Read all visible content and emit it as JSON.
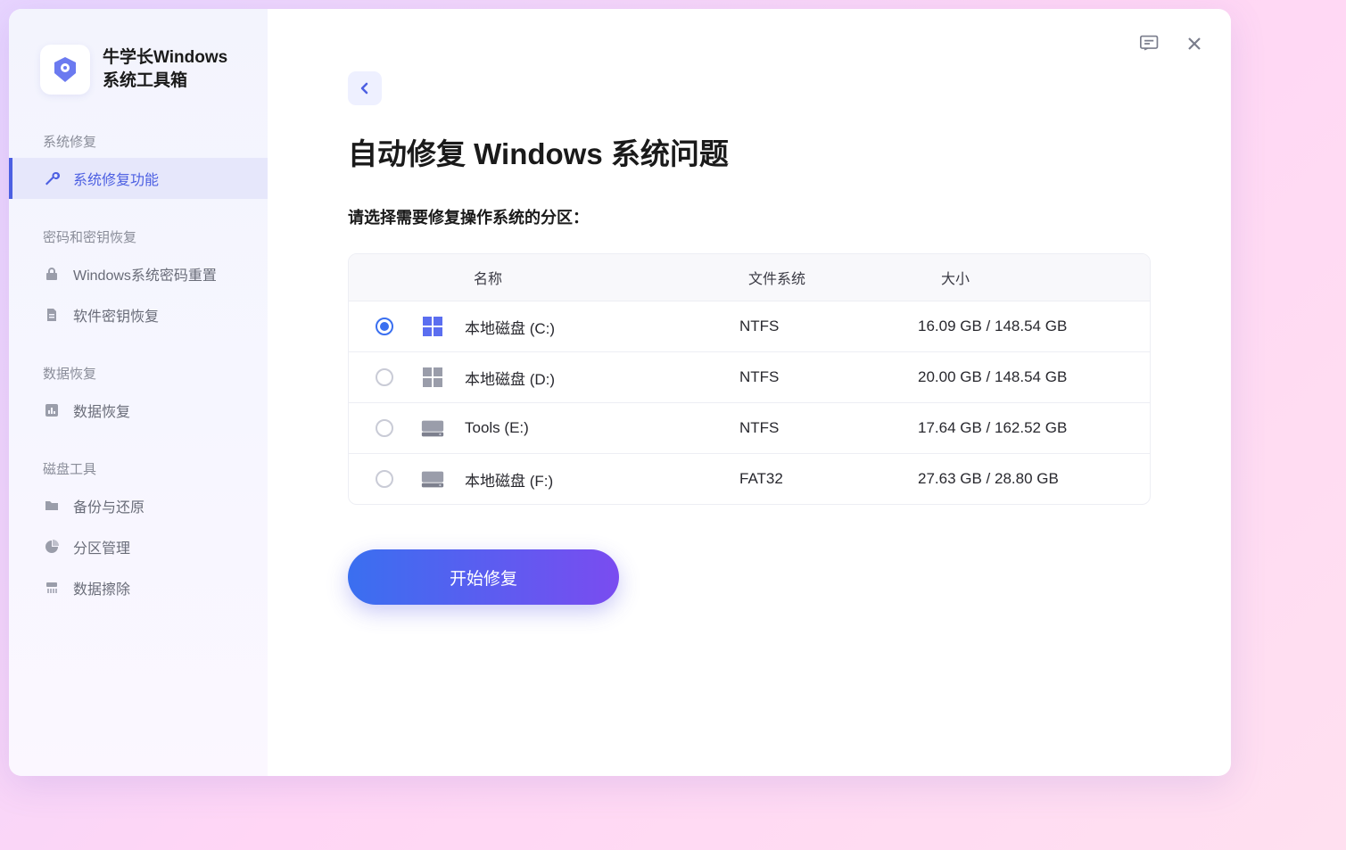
{
  "app": {
    "title": "牛学长Windows系统工具箱"
  },
  "sidebar": {
    "sections": [
      {
        "label": "系统修复",
        "items": [
          {
            "id": "sysrepair",
            "label": "系统修复功能",
            "icon": "wrench",
            "active": true
          }
        ]
      },
      {
        "label": "密码和密钥恢复",
        "items": [
          {
            "id": "winpwd",
            "label": "Windows系统密码重置",
            "icon": "lock",
            "active": false
          },
          {
            "id": "softkey",
            "label": "软件密钥恢复",
            "icon": "file",
            "active": false
          }
        ]
      },
      {
        "label": "数据恢复",
        "items": [
          {
            "id": "datarec",
            "label": "数据恢复",
            "icon": "chart",
            "active": false
          }
        ]
      },
      {
        "label": "磁盘工具",
        "items": [
          {
            "id": "backup",
            "label": "备份与还原",
            "icon": "folder",
            "active": false
          },
          {
            "id": "partition",
            "label": "分区管理",
            "icon": "pie",
            "active": false
          },
          {
            "id": "wipe",
            "label": "数据擦除",
            "icon": "shred",
            "active": false
          }
        ]
      }
    ]
  },
  "main": {
    "title": "自动修复 Windows 系统问题",
    "subtitle": "请选择需要修复操作系统的分区：",
    "table": {
      "headers": {
        "name": "名称",
        "fs": "文件系统",
        "size": "大小"
      },
      "rows": [
        {
          "selected": true,
          "kind": "windows",
          "name": "本地磁盘 (C:)",
          "fs": "NTFS",
          "size": "16.09 GB / 148.54 GB"
        },
        {
          "selected": false,
          "kind": "windows",
          "name": "本地磁盘 (D:)",
          "fs": "NTFS",
          "size": "20.00 GB / 148.54 GB"
        },
        {
          "selected": false,
          "kind": "drive",
          "name": "Tools (E:)",
          "fs": "NTFS",
          "size": "17.64 GB / 162.52 GB"
        },
        {
          "selected": false,
          "kind": "drive",
          "name": "本地磁盘 (F:)",
          "fs": "FAT32",
          "size": "27.63 GB / 28.80 GB"
        }
      ]
    },
    "start_label": "开始修复"
  }
}
